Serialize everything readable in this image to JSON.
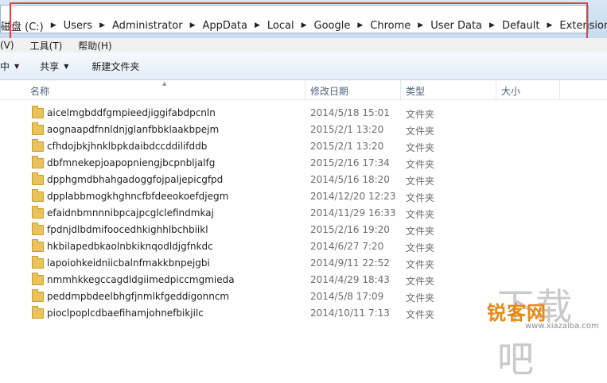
{
  "address_bar": {
    "crumbs": [
      "磁盘 (C:)",
      "Users",
      "Administrator",
      "AppData",
      "Local",
      "Google",
      "Chrome",
      "User Data",
      "Default",
      "Extensions"
    ]
  },
  "menu": {
    "items": [
      "(V)",
      "工具(T)",
      "帮助(H)"
    ]
  },
  "toolbar": {
    "left_cut": "中",
    "share_label": "共享",
    "new_folder_label": "新建文件夹"
  },
  "columns": {
    "name": "名称",
    "date": "修改日期",
    "type": "类型",
    "size": "大小"
  },
  "files": [
    {
      "name": "aicelmgbddfgmpieedjiggifabdpcnln",
      "date": "2014/5/18 15:01",
      "type": "文件夹"
    },
    {
      "name": "aognaapdfnnldnjglanfbbklaakbpejm",
      "date": "2015/2/1 13:20",
      "type": "文件夹"
    },
    {
      "name": "cfhdojbkjhnklbpkdaibdccddilifddb",
      "date": "2015/2/1 13:20",
      "type": "文件夹"
    },
    {
      "name": "dbfmnekepjoapopniengjbcpnbljalfg",
      "date": "2015/2/16 17:34",
      "type": "文件夹"
    },
    {
      "name": "dpphgmdbhahgadoggfojpaljepicgfpd",
      "date": "2014/5/16 18:20",
      "type": "文件夹"
    },
    {
      "name": "dpplabbmogkhghncfbfdeeokoefdjegm",
      "date": "2014/12/20 12:23",
      "type": "文件夹"
    },
    {
      "name": "efaidnbmnnnibpcajpcglclefindmkaj",
      "date": "2014/11/29 16:33",
      "type": "文件夹"
    },
    {
      "name": "fpdnjdlbdmifoocedhkighhlbchbiikl",
      "date": "2015/2/16 19:20",
      "type": "文件夹"
    },
    {
      "name": "hkbilapedbkaolnbkiknqodldjgfnkdc",
      "date": "2014/6/27 7:20",
      "type": "文件夹"
    },
    {
      "name": "lapoiohkeidniicbalnfmakkbnpejgbi",
      "date": "2014/9/11 22:52",
      "type": "文件夹"
    },
    {
      "name": "nmmhkkegccagdldgiimedpiccmgmieda",
      "date": "2014/4/29 18:43",
      "type": "文件夹"
    },
    {
      "name": "peddmpbdeelbhgfjnmlkfgeddigonncm",
      "date": "2014/5/8 17:09",
      "type": "文件夹"
    },
    {
      "name": "pioclpoplcdbaefihamjohnefbikjilc",
      "date": "2014/10/11 7:13",
      "type": "文件夹"
    }
  ],
  "watermark": {
    "big": "下载吧",
    "logo": "锐客网",
    "url": "www.xiazaiba.com"
  },
  "colors": {
    "highlight_box": "#d9464a",
    "folder": "#e8c35c",
    "header_text": "#4c607a"
  }
}
